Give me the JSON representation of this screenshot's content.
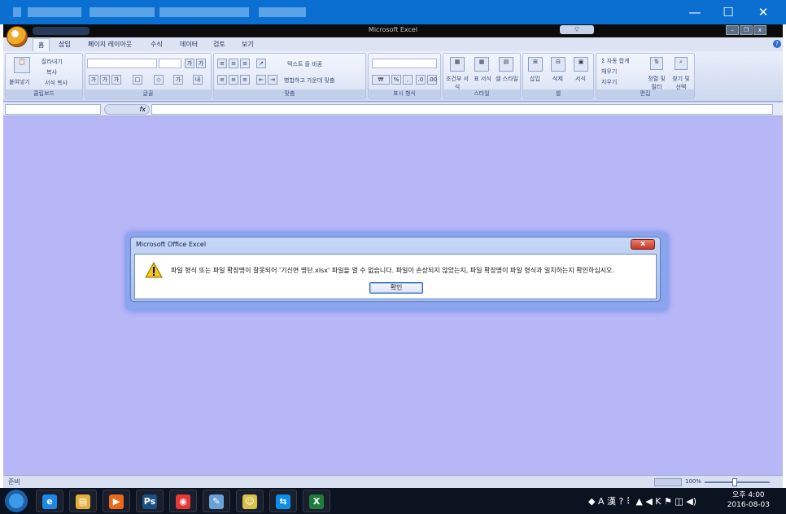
{
  "outer_window": {
    "controls": {
      "minimize": "—",
      "maximize": "☐",
      "close": "✕"
    }
  },
  "excel": {
    "title": "Microsoft Excel",
    "window_controls": {
      "minimize": "–",
      "restore": "❐",
      "close": "x"
    },
    "tabs": [
      "홈",
      "삽입",
      "페이지 레이아웃",
      "수식",
      "데이터",
      "검토",
      "보기"
    ],
    "ribbon": {
      "clipboard": {
        "label": "클립보드",
        "paste": "붙여넣기",
        "cut": "잘라내기",
        "copy": "복사",
        "format_painter": "서식 복사"
      },
      "font": {
        "label": "글꼴"
      },
      "alignment": {
        "label": "맞춤",
        "wrap_text": "텍스트 줄 바꿈",
        "merge_center": "병합하고 가운데 맞춤"
      },
      "number": {
        "label": "표시 형식"
      },
      "styles": {
        "label": "스타일",
        "conditional_format": "조건부 서식",
        "format_as_table": "표 서식",
        "cell_styles": "셀 스타일"
      },
      "cells": {
        "label": "셀",
        "insert": "삽입",
        "delete": "삭제",
        "format": "서식"
      },
      "editing": {
        "label": "편집",
        "autosum": "Σ 자동 합계",
        "fill": "채우기",
        "clear": "지우기",
        "sort_filter": "정렬 및 필터",
        "find_select": "찾기 및 선택"
      }
    },
    "formula_bar": {
      "fx": "fx"
    },
    "status": {
      "ready": "준비",
      "zoom": "100%"
    }
  },
  "dialog": {
    "title": "Microsoft Office Excel",
    "close": "x",
    "message": "파일 형식 또는 파일 확장명이 잘못되어 '기신면 명단.xlsx' 파일을 열 수 없습니다. 파일이 손상되지 않았는지, 파일 확장명이 파일 형식과 일치하는지 확인하십시오.",
    "ok_label": "확인"
  },
  "taskbar": {
    "apps": [
      {
        "name": "ie-icon",
        "glyph": "e",
        "color": "#1e88e5"
      },
      {
        "name": "explorer-icon",
        "glyph": "▤",
        "color": "#e2b13c"
      },
      {
        "name": "media-player-icon",
        "glyph": "▶",
        "color": "#e86a1a"
      },
      {
        "name": "photoshop-icon",
        "glyph": "Ps",
        "color": "#1c4f86"
      },
      {
        "name": "app-red-icon",
        "glyph": "◉",
        "color": "#e53935"
      },
      {
        "name": "notepad-icon",
        "glyph": "✎",
        "color": "#6aa0d8"
      },
      {
        "name": "kakaotalk-icon",
        "glyph": "☺",
        "color": "#d8c04a"
      },
      {
        "name": "teamviewer-icon",
        "glyph": "⇆",
        "color": "#0e8ee9"
      },
      {
        "name": "excel-icon",
        "glyph": "X",
        "color": "#1e7c3c"
      }
    ],
    "tray": "◆ A 漢 ? ⠇ ▲ ◀ K ⚑ ◫ ◀)",
    "time": "오후 4:00",
    "date": "2016-08-03"
  }
}
